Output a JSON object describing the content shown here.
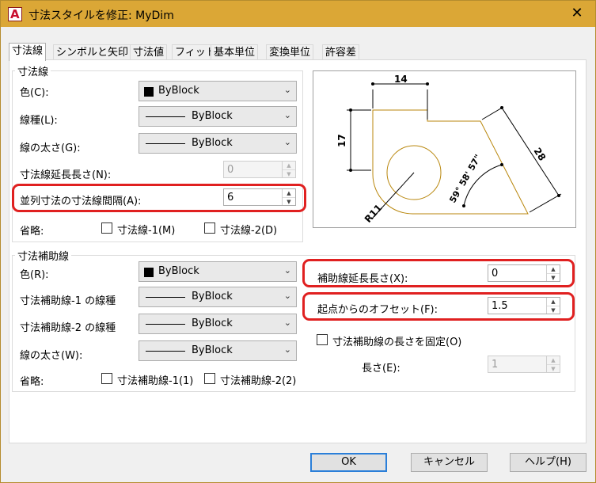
{
  "window": {
    "title": "寸法スタイルを修正: MyDim",
    "app_icon": "autocad-a-icon",
    "close_glyph": "✕"
  },
  "tabs": [
    {
      "label": "寸法線",
      "active": true
    },
    {
      "label": "シンボルと矢印",
      "active": false
    },
    {
      "label": "寸法値",
      "active": false
    },
    {
      "label": "フィット",
      "active": false
    },
    {
      "label": "基本単位",
      "active": false
    },
    {
      "label": "変換単位",
      "active": false
    },
    {
      "label": "許容差",
      "active": false
    }
  ],
  "dim_lines": {
    "group_label": "寸法線",
    "color_label": "色(C):",
    "color_value": "ByBlock",
    "linetype_label": "線種(L):",
    "linetype_value": "ByBlock",
    "lineweight_label": "線の太さ(G):",
    "lineweight_value": "ByBlock",
    "extend_label": "寸法線延長長さ(N):",
    "extend_value": "0",
    "baseline_label": "並列寸法の寸法線間隔(A):",
    "baseline_value": "6",
    "suppress_label": "省略:",
    "suppress_1": "寸法線-1(M)",
    "suppress_2": "寸法線-2(D)"
  },
  "ext_lines": {
    "group_label": "寸法補助線",
    "color_label": "色(R):",
    "color_value": "ByBlock",
    "linetype1_label": "寸法補助線-1 の線種",
    "linetype1_value": "ByBlock",
    "linetype2_label": "寸法補助線-2 の線種",
    "linetype2_value": "ByBlock",
    "lineweight_label": "線の太さ(W):",
    "lineweight_value": "ByBlock",
    "suppress_label": "省略:",
    "suppress_1": "寸法補助線-1(1)",
    "suppress_2": "寸法補助線-2(2)",
    "extend_label": "補助線延長長さ(X):",
    "extend_value": "0",
    "offset_label": "起点からのオフセット(F):",
    "offset_value": "1.5",
    "fixed_label": "寸法補助線の長さを固定(O)",
    "length_label": "長さ(E):",
    "length_value": "1"
  },
  "preview": {
    "dim_top": "14",
    "dim_left": "17",
    "dim_diag": "28",
    "dim_angle": "59° 58' 57\"",
    "dim_radius": "R11"
  },
  "buttons": {
    "ok": "OK",
    "cancel": "キャンセル",
    "help": "ヘルプ(H)"
  },
  "colors": {
    "titlebar": "#dba736",
    "highlight": "#e02020",
    "geometry": "#b8860b",
    "ok_border": "#2b7fd9"
  }
}
